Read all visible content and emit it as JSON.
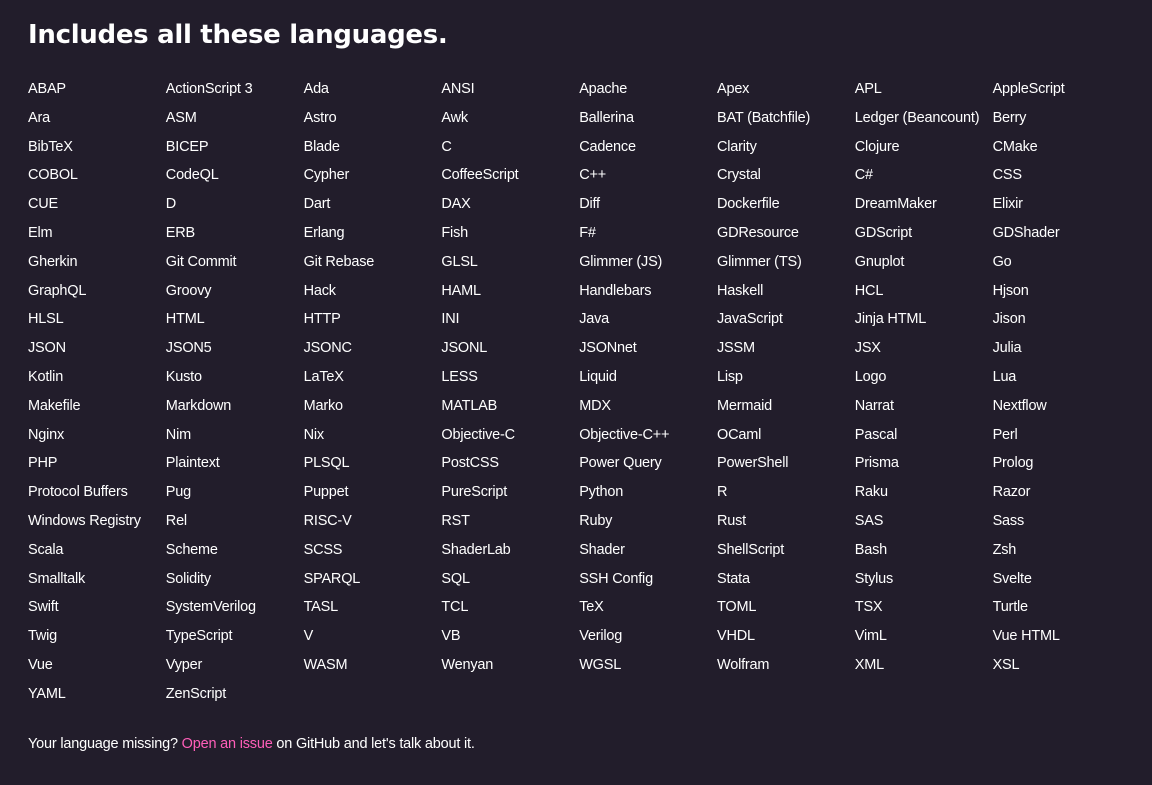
{
  "heading": "Includes all these languages.",
  "languages": [
    "ABAP",
    "ActionScript 3",
    "Ada",
    "ANSI",
    "Apache",
    "Apex",
    "APL",
    "AppleScript",
    "Ara",
    "ASM",
    "Astro",
    "Awk",
    "Ballerina",
    "BAT (Batchfile)",
    "Ledger (Beancount)",
    "Berry",
    "BibTeX",
    "BICEP",
    "Blade",
    "C",
    "Cadence",
    "Clarity",
    "Clojure",
    "CMake",
    "COBOL",
    "CodeQL",
    "Cypher",
    "CoffeeScript",
    "C++",
    "Crystal",
    "C#",
    "CSS",
    "CUE",
    "D",
    "Dart",
    "DAX",
    "Diff",
    "Dockerfile",
    "DreamMaker",
    "Elixir",
    "Elm",
    "ERB",
    "Erlang",
    "Fish",
    "F#",
    "GDResource",
    "GDScript",
    "GDShader",
    "Gherkin",
    "Git Commit",
    "Git Rebase",
    "GLSL",
    "Glimmer (JS)",
    "Glimmer (TS)",
    "Gnuplot",
    "Go",
    "GraphQL",
    "Groovy",
    "Hack",
    "HAML",
    "Handlebars",
    "Haskell",
    "HCL",
    "Hjson",
    "HLSL",
    "HTML",
    "HTTP",
    "INI",
    "Java",
    "JavaScript",
    "Jinja HTML",
    "Jison",
    "JSON",
    "JSON5",
    "JSONC",
    "JSONL",
    "JSONnet",
    "JSSM",
    "JSX",
    "Julia",
    "Kotlin",
    "Kusto",
    "LaTeX",
    "LESS",
    "Liquid",
    "Lisp",
    "Logo",
    "Lua",
    "Makefile",
    "Markdown",
    "Marko",
    "MATLAB",
    "MDX",
    "Mermaid",
    "Narrat",
    "Nextflow",
    "Nginx",
    "Nim",
    "Nix",
    "Objective-C",
    "Objective-C++",
    "OCaml",
    "Pascal",
    "Perl",
    "PHP",
    "Plaintext",
    "PLSQL",
    "PostCSS",
    "Power Query",
    "PowerShell",
    "Prisma",
    "Prolog",
    "Protocol Buffers",
    "Pug",
    "Puppet",
    "PureScript",
    "Python",
    "R",
    "Raku",
    "Razor",
    "Windows Registry",
    "Rel",
    "RISC-V",
    "RST",
    "Ruby",
    "Rust",
    "SAS",
    "Sass",
    "Scala",
    "Scheme",
    "SCSS",
    "ShaderLab",
    "Shader",
    "ShellScript",
    "Bash",
    "Zsh",
    "Smalltalk",
    "Solidity",
    "SPARQL",
    "SQL",
    "SSH Config",
    "Stata",
    "Stylus",
    "Svelte",
    "Swift",
    "SystemVerilog",
    "TASL",
    "TCL",
    "TeX",
    "TOML",
    "TSX",
    "Turtle",
    "Twig",
    "TypeScript",
    "V",
    "VB",
    "Verilog",
    "VHDL",
    "VimL",
    "Vue HTML",
    "Vue",
    "Vyper",
    "WASM",
    "Wenyan",
    "WGSL",
    "Wolfram",
    "XML",
    "XSL",
    "YAML",
    "ZenScript"
  ],
  "footer": {
    "prefix": "Your language missing? ",
    "link_label": "Open an issue",
    "suffix": " on GitHub and let's talk about it."
  },
  "colors": {
    "background": "#221d2b",
    "text": "#ffffff",
    "link": "#ff5eb9"
  }
}
